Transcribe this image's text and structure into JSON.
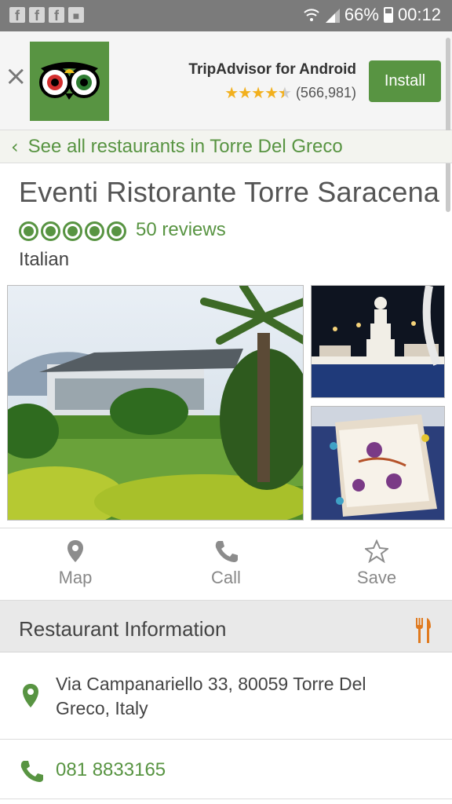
{
  "status_bar": {
    "notification_icons": [
      "facebook-icon",
      "facebook-icon",
      "facebook-icon",
      "shopping-bag-icon"
    ],
    "battery": "66%",
    "time": "00:12"
  },
  "banner": {
    "app_name": "TripAdvisor for Android",
    "rating_count": "(566,981)",
    "rating_stars": 4.5,
    "install_label": "Install",
    "logo_icon": "tripadvisor-owl-icon",
    "close_icon": "close-icon"
  },
  "nav": {
    "back_link": "See all restaurants in Torre Del Greco"
  },
  "restaurant": {
    "name": "Eventi Ristorante Torre Saracena",
    "rating_bubbles": 5,
    "reviews": "50 reviews",
    "cuisine": "Italian"
  },
  "actions": [
    {
      "label": "Map",
      "icon": "map-pin-icon"
    },
    {
      "label": "Call",
      "icon": "phone-icon"
    },
    {
      "label": "Save",
      "icon": "star-icon"
    }
  ],
  "info": {
    "section_title": "Restaurant Information",
    "section_icon": "fork-knife-icon",
    "address": "Via Campanariello 33, 80059 Torre Del Greco, Italy",
    "phone": "081 8833165"
  },
  "colors": {
    "brand_green": "#589442",
    "accent_orange": "#e07a1f",
    "star_yellow": "#f2b01e"
  }
}
